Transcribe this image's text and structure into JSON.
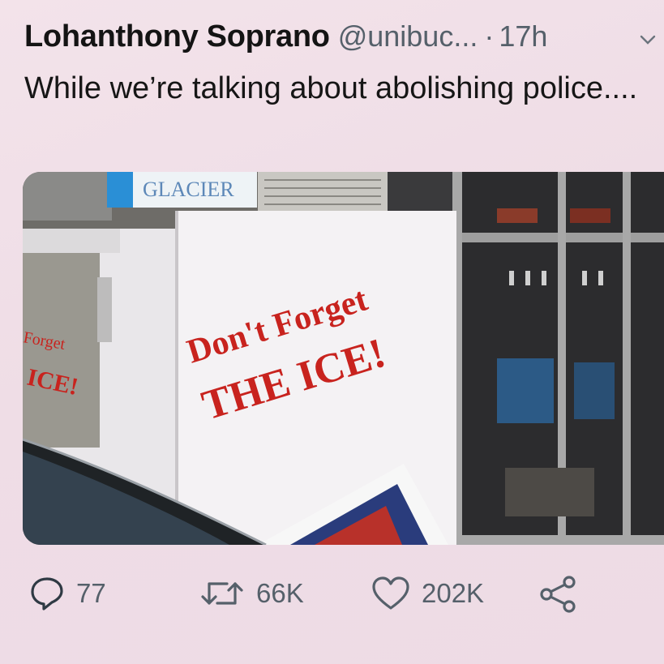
{
  "tweet": {
    "display_name": "Lohanthony Soprano",
    "handle": "@unibuc...",
    "separator": "·",
    "time": "17h",
    "text": "While we’re talking about abolishing police....",
    "media": {
      "sign_top": "GLACIER",
      "line1": "Don't Forget",
      "line2": "THE ICE!",
      "side_line1": "Forget",
      "side_line2": "ICE!"
    }
  },
  "actions": {
    "replies": "77",
    "retweets": "66K",
    "likes": "202K"
  },
  "icons": {
    "more": "chevron-down-icon",
    "reply": "reply-icon",
    "retweet": "retweet-icon",
    "like": "heart-icon",
    "share": "share-icon"
  },
  "colors": {
    "text": "#141414",
    "muted": "#55606a",
    "sign_red": "#c8231e"
  }
}
